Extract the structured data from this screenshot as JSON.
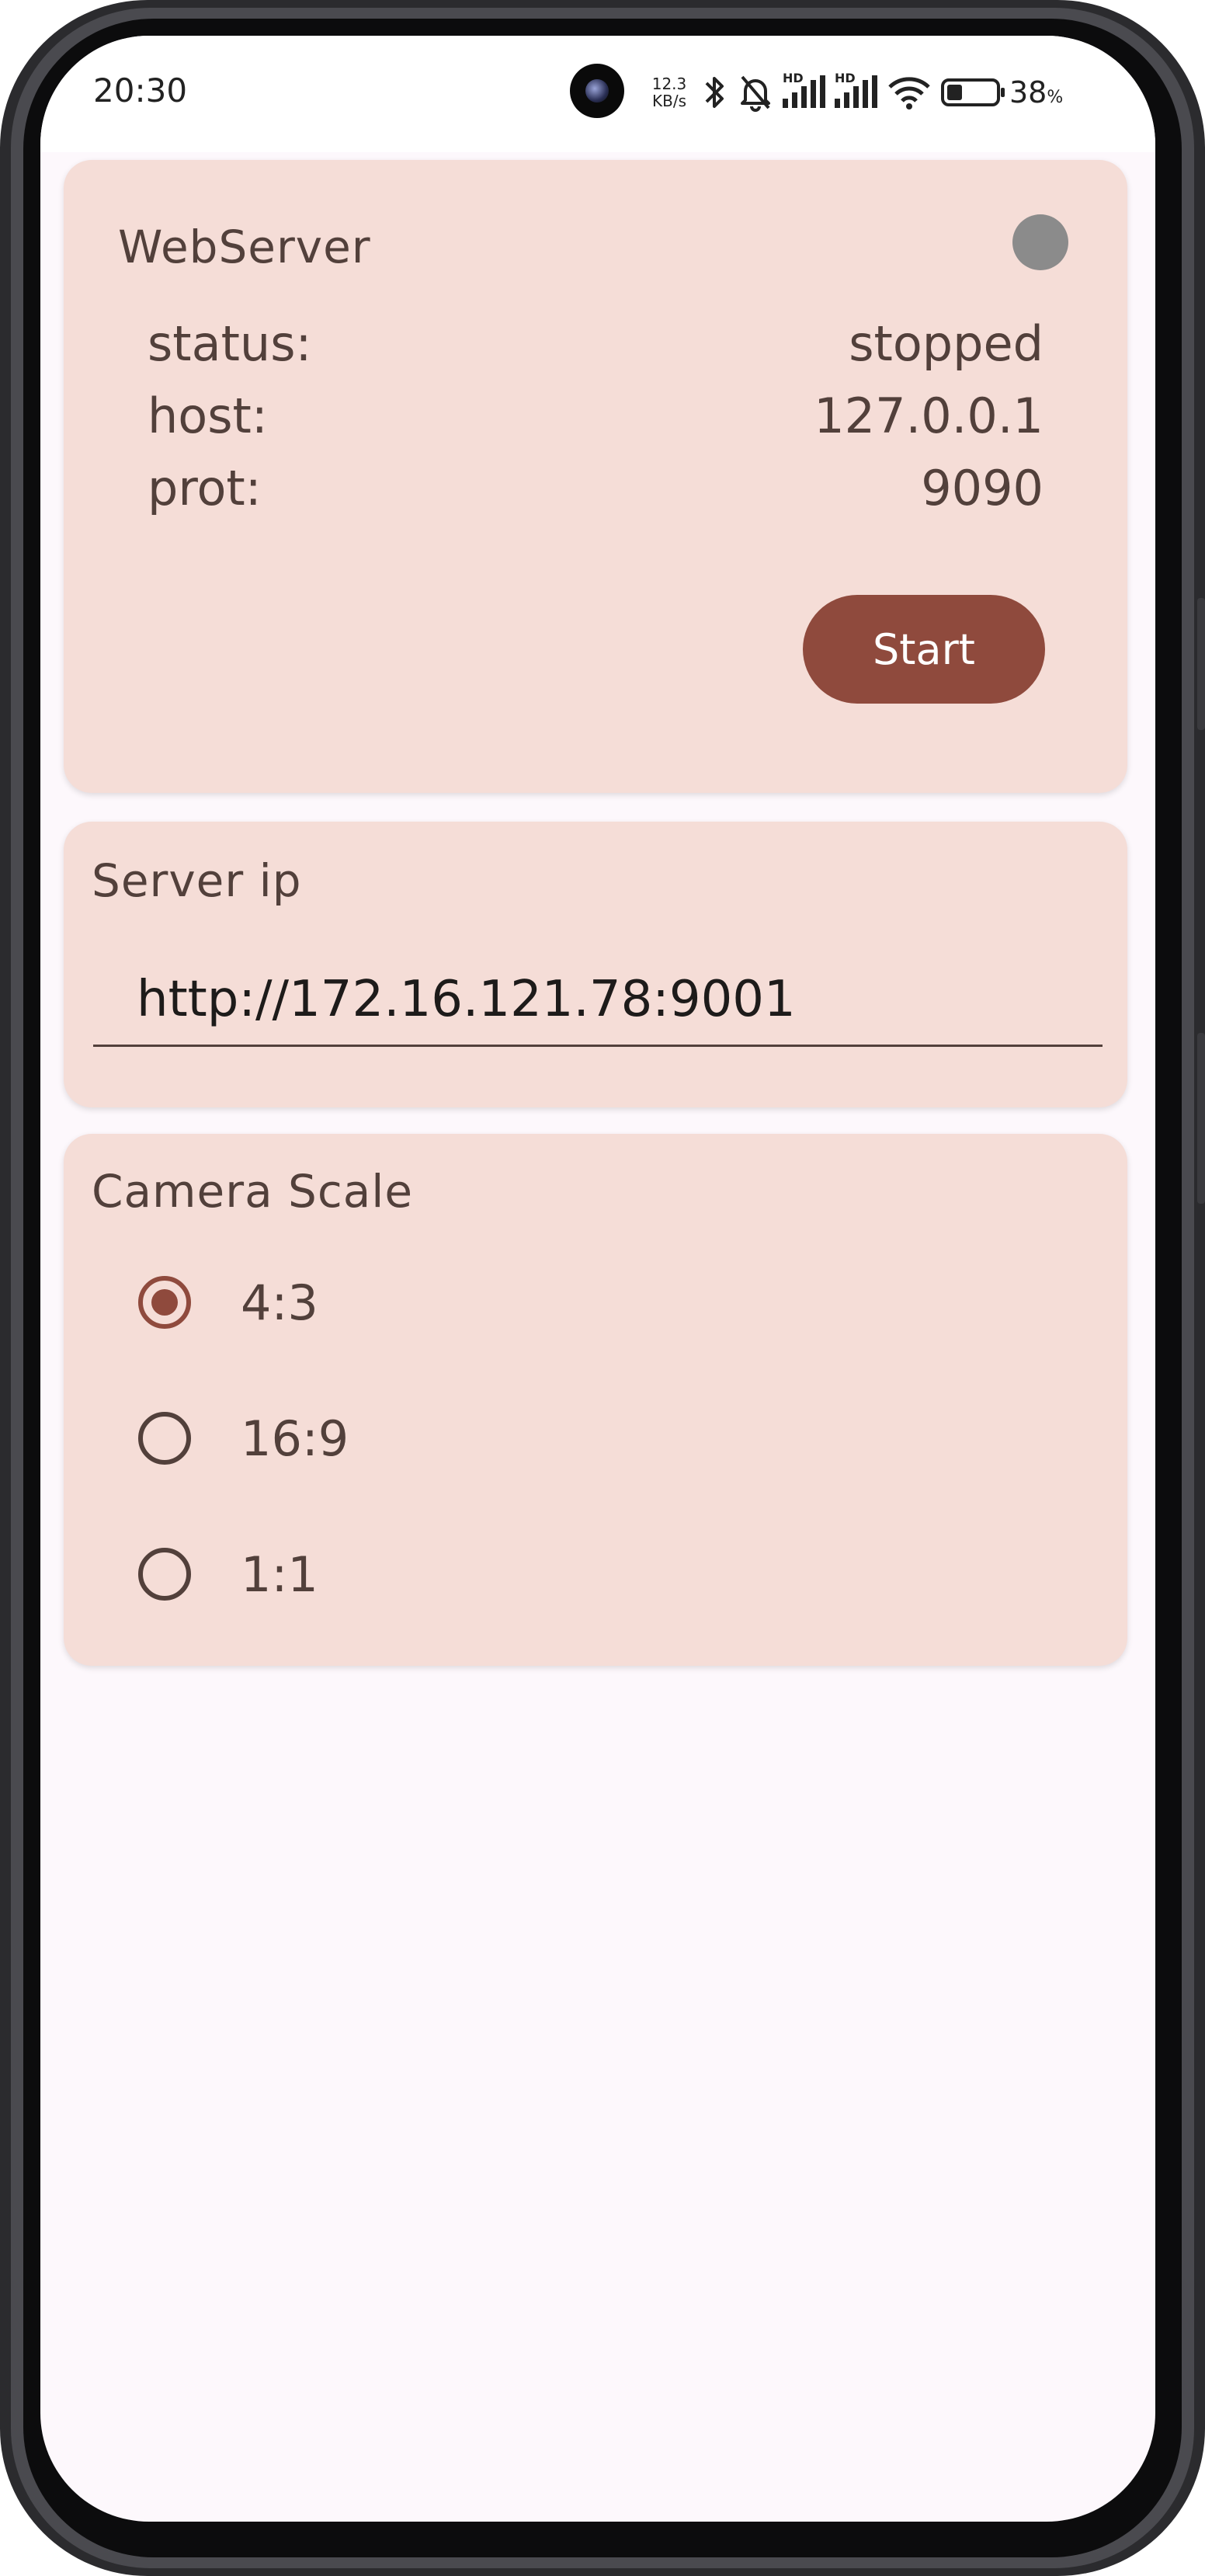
{
  "status_bar": {
    "time": "20:30",
    "net_speed_value": "12.3",
    "net_speed_unit": "KB/s",
    "hd_label_1": "HD",
    "hd_label_2": "HD",
    "battery_level": 0.38,
    "battery_percent": "38",
    "battery_unit": "%"
  },
  "webserver": {
    "title": "WebServer",
    "indicator_color": "#8b8b8b",
    "rows": [
      {
        "label": "status:",
        "value": "stopped"
      },
      {
        "label": "host:",
        "value": "127.0.0.1"
      },
      {
        "label": "prot:",
        "value": "9090"
      }
    ],
    "start_label": "Start"
  },
  "server_ip": {
    "title": "Server ip",
    "value": "http://172.16.121.78:9001"
  },
  "camera_scale": {
    "title": "Camera Scale",
    "options": [
      {
        "label": "4:3",
        "selected": true
      },
      {
        "label": "16:9",
        "selected": false
      },
      {
        "label": "1:1",
        "selected": false
      }
    ]
  },
  "colors": {
    "card_bg": "#f5ddd7",
    "accent": "#8f4a3d",
    "text": "#52403b",
    "screen_bg": "#fdf8fc"
  }
}
